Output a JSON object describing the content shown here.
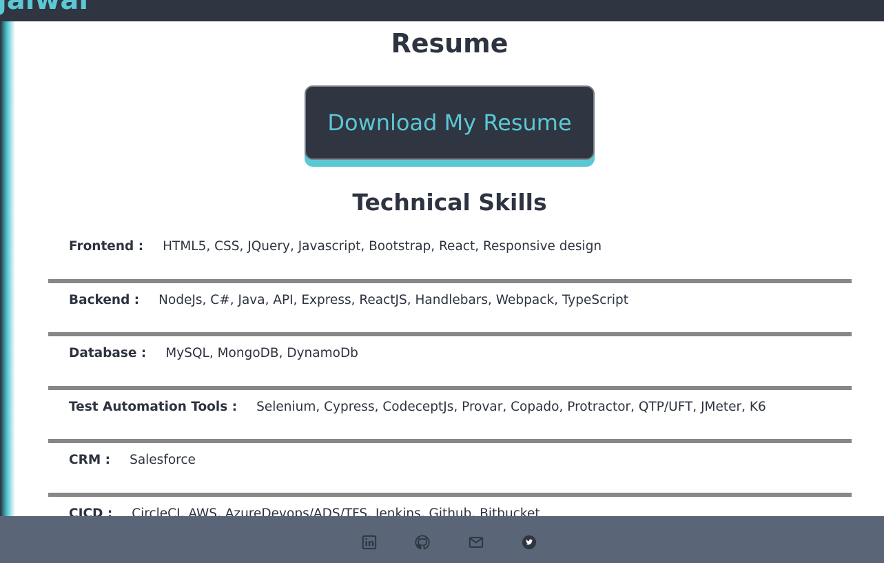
{
  "header": {
    "brand_text": "jalwal"
  },
  "resume": {
    "title": "Resume",
    "download_label": "Download My Resume"
  },
  "skills": {
    "title": "Technical Skills",
    "items": [
      {
        "label": "Frontend :",
        "value": "HTML5, CSS, JQuery, Javascript, Bootstrap, React, Responsive design"
      },
      {
        "label": "Backend :",
        "value": "NodeJs, C#, Java, API, Express, ReactJS, Handlebars, Webpack, TypeScript"
      },
      {
        "label": "Database :",
        "value": "MySQL, MongoDB, DynamoDb"
      },
      {
        "label": "Test Automation Tools :",
        "value": "Selenium, Cypress, CodeceptJs, Provar, Copado, Protractor, QTP/UFT, JMeter, K6"
      },
      {
        "label": "CRM :",
        "value": "Salesforce"
      },
      {
        "label": "CICD :",
        "value": "CircleCI, AWS, AzureDevops/ADS/TFS, Jenkins, Github, Bitbucket"
      }
    ]
  },
  "footer": {
    "icons": [
      "linkedin-icon",
      "github-icon",
      "mail-icon",
      "twitter-icon"
    ]
  },
  "colors": {
    "header_bg": "#2f3541",
    "accent": "#5bc8d3",
    "footer_bg": "#5a6577",
    "divider": "#878787",
    "text": "#2d3340"
  }
}
